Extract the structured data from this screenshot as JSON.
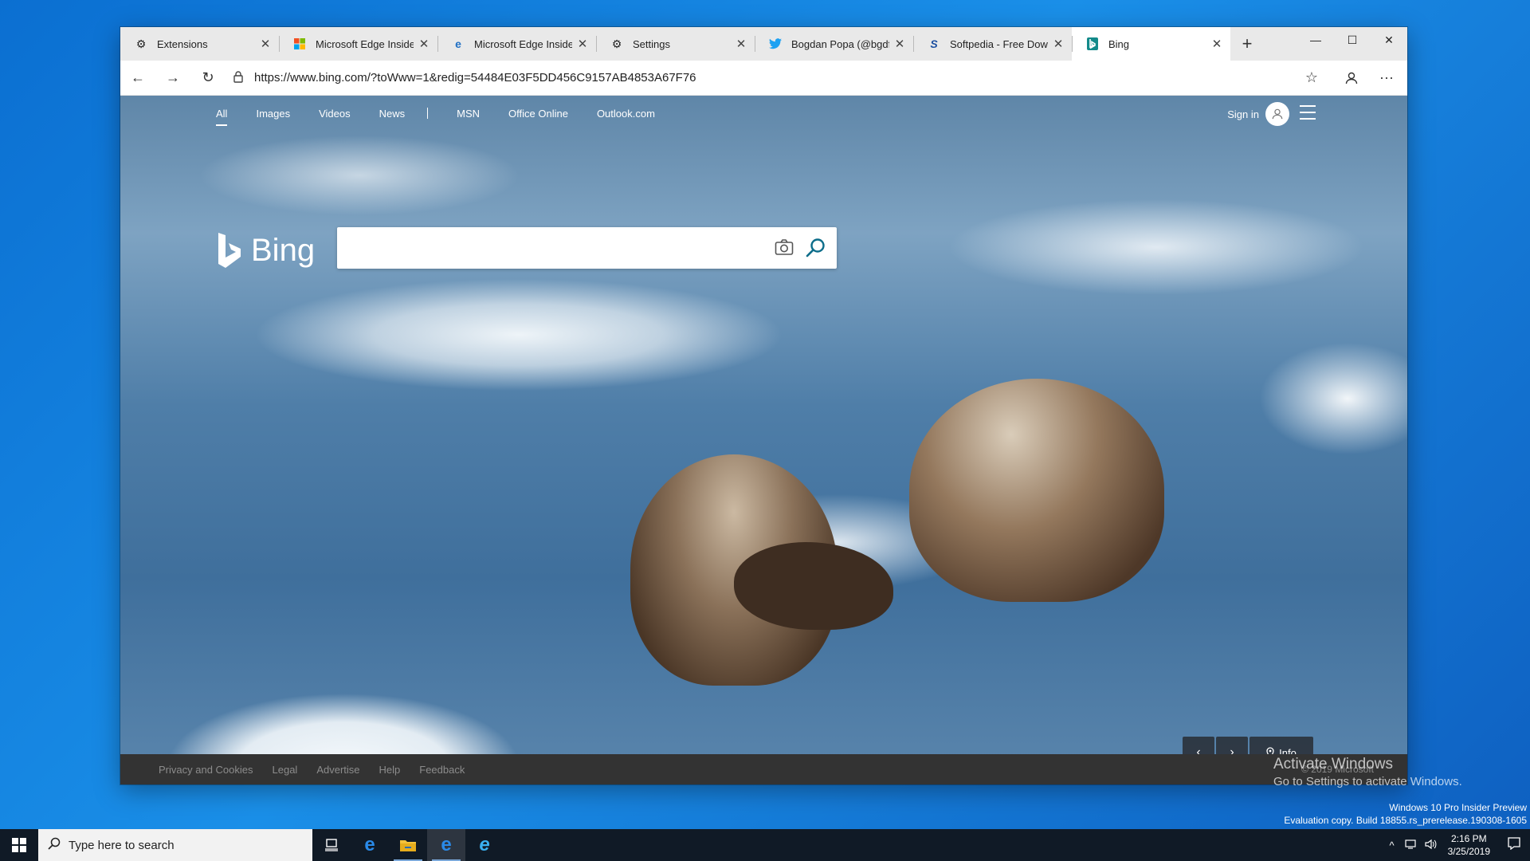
{
  "browser": {
    "tabs": [
      {
        "title": "Extensions",
        "icon": "gear-icon"
      },
      {
        "title": "Microsoft Edge Insider A",
        "icon": "microsoft-logo-icon"
      },
      {
        "title": "Microsoft Edge Insider",
        "icon": "edge-icon"
      },
      {
        "title": "Settings",
        "icon": "gear-icon"
      },
      {
        "title": "Bogdan Popa (@bgdftw)",
        "icon": "twitter-icon"
      },
      {
        "title": "Softpedia - Free Downlo",
        "icon": "softpedia-icon"
      },
      {
        "title": "Bing",
        "icon": "bing-icon",
        "active": true
      }
    ],
    "new_tab": "+",
    "address": "https://www.bing.com/?toWww=1&redig=54484E03F5DD456C9157AB4853A67F76"
  },
  "bing": {
    "nav": [
      "All",
      "Images",
      "Videos",
      "News",
      "MSN",
      "Office Online",
      "Outlook.com"
    ],
    "signin": "Sign in",
    "logo_text": "Bing",
    "search_value": "",
    "info_label": "Info",
    "footer": [
      "Privacy and Cookies",
      "Legal",
      "Advertise",
      "Help",
      "Feedback"
    ],
    "copyright": "© 2019 Microsoft"
  },
  "desktop": {
    "activate_title": "Activate Windows",
    "activate_sub": "Go to Settings to activate Windows.",
    "edition": "Windows 10 Pro Insider Preview",
    "build": "Evaluation copy. Build 18855.rs_prerelease.190308-1605"
  },
  "taskbar": {
    "search_placeholder": "Type here to search",
    "time": "2:16 PM",
    "date": "3/25/2019"
  },
  "colors": {
    "accent": "#0078d7",
    "taskbar": "#101a26"
  }
}
